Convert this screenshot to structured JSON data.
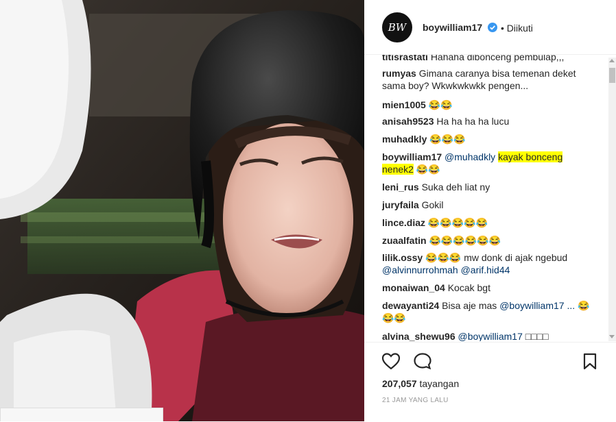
{
  "header": {
    "avatar_text": "BW",
    "username": "boywilliam17",
    "follow_status": "• Diikuti"
  },
  "comments": [
    {
      "user": "titisrastati",
      "pre": "",
      "text": "Hahaha dibonceng pembulap,,,"
    },
    {
      "user": "rumyas",
      "pre": "",
      "text": "Gimana caranya bisa temenan deket sama boy? Wkwkwkwkk pengen..."
    },
    {
      "user": "mien1005",
      "pre": "",
      "text": "😂😂"
    },
    {
      "user": "anisah9523",
      "pre": "",
      "text": "Ha ha ha ha lucu"
    },
    {
      "user": "muhadkly",
      "pre": "",
      "text": "😂😂😂"
    },
    {
      "user": "boywilliam17",
      "pre": "@muhadkly",
      "highlight": "kayak bonceng nenek2",
      "text": "😂😂"
    },
    {
      "user": "leni_rus",
      "pre": "",
      "text": "Suka deh liat ny"
    },
    {
      "user": "juryfaila",
      "pre": "",
      "text": "Gokil"
    },
    {
      "user": "lince.diaz",
      "pre": "",
      "text": "😂😂😂😂😂"
    },
    {
      "user": "zuaalfatin",
      "pre": "",
      "text": "😂😂😂😂😂😂"
    },
    {
      "user": "lilik.ossy",
      "pre": "",
      "text": "😂😂😂 mw donk di ajak ngebud",
      "mentions": "@alvinnurrohmah @arif.hid44"
    },
    {
      "user": "monaiwan_04",
      "pre": "",
      "text": "Kocak bgt"
    },
    {
      "user": "dewayanti24",
      "pre": "",
      "text": "Bisa aje mas",
      "mentions": "@boywilliam17 ...",
      "tail": "😂😂😂"
    },
    {
      "user": "alvina_shewu96",
      "pre": "@boywilliam17",
      "text": "□□□□"
    }
  ],
  "stats": {
    "views_count": "207,057",
    "views_label": "tayangan",
    "posted_time": "21 JAM YANG LALU"
  },
  "colors": {
    "text": "#262626",
    "mention": "#003569",
    "highlight": "#ffff00",
    "verified": "#3897f0",
    "muted": "#999999"
  },
  "icons": [
    "verified-icon",
    "heart-icon",
    "comment-icon",
    "bookmark-icon"
  ]
}
